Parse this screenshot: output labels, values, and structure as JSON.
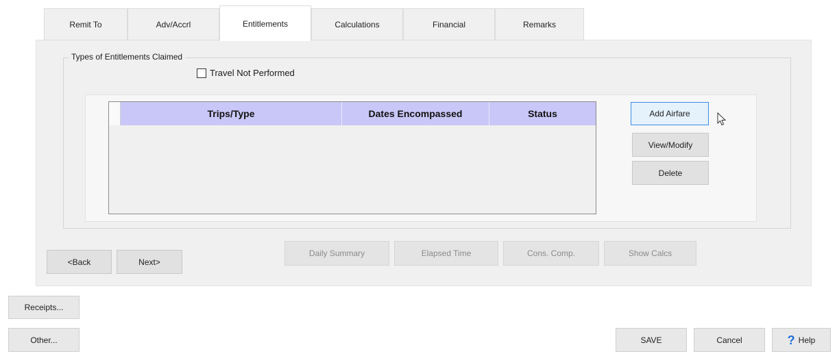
{
  "tabs": [
    {
      "label": "Remit To"
    },
    {
      "label": "Adv/Accrl"
    },
    {
      "label": "Entitlements"
    },
    {
      "label": "Calculations"
    },
    {
      "label": "Financial"
    },
    {
      "label": "Remarks"
    }
  ],
  "active_tab": "Entitlements",
  "group": {
    "title": "Types of Entitlements Claimed"
  },
  "travel_not_performed": {
    "label": "Travel Not Performed",
    "checked": false
  },
  "grid": {
    "columns": [
      "Trips/Type",
      "Dates Encompassed",
      "Status"
    ],
    "rows": []
  },
  "side_buttons": {
    "add": "Add Airfare",
    "view": "View/Modify",
    "delete": "Delete"
  },
  "nav": {
    "back": "<Back",
    "next": "Next>"
  },
  "calc_buttons": {
    "daily": "Daily Summary",
    "elapsed": "Elapsed Time",
    "cons": "Cons. Comp.",
    "show": "Show Calcs"
  },
  "footer": {
    "receipts": "Receipts...",
    "other": "Other...",
    "save": "SAVE",
    "cancel": "Cancel",
    "help": "Help",
    "help_icon": "?"
  }
}
